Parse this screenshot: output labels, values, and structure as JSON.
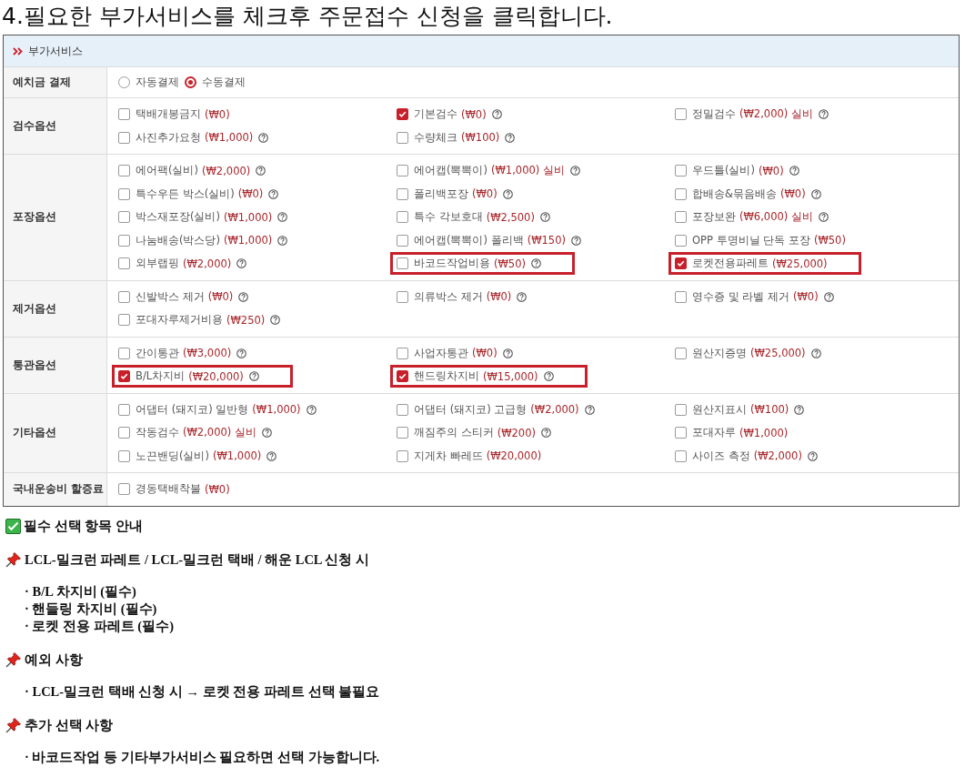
{
  "heading": "4.필요한 부가서비스를 체크후 주문접수 신청을 클릭합니다.",
  "panel": {
    "title": "부가서비스",
    "rows": [
      {
        "label": "예치금 결제",
        "kind": "radio",
        "options": [
          {
            "label": "자동결제",
            "selected": false
          },
          {
            "label": "수동결제",
            "selected": true
          }
        ]
      },
      {
        "label": "검수옵션",
        "kind": "checks",
        "options": [
          {
            "name": "택배개봉금지",
            "price": "(₩0)",
            "help": false,
            "checked": false,
            "highlighted": false
          },
          {
            "name": "기본검수",
            "price": "(₩0)",
            "help": true,
            "checked": true,
            "highlighted": false
          },
          {
            "name": "정밀검수",
            "price": "(₩2,000) 실비",
            "help": true,
            "checked": false,
            "highlighted": false
          },
          {
            "name": "사진추가요청",
            "price": "(₩1,000)",
            "help": true,
            "checked": false,
            "highlighted": false
          },
          {
            "name": "수량체크",
            "price": "(₩100)",
            "help": true,
            "checked": false,
            "highlighted": false
          }
        ]
      },
      {
        "label": "포장옵션",
        "kind": "checks",
        "options": [
          {
            "name": "에어팩(실비)",
            "price": "(₩2,000)",
            "help": true,
            "checked": false,
            "highlighted": false
          },
          {
            "name": "에어캡(뽁뽁이)",
            "price": "(₩1,000) 실비",
            "help": true,
            "checked": false,
            "highlighted": false
          },
          {
            "name": "우드틀(실비)",
            "price": "(₩0)",
            "help": true,
            "checked": false,
            "highlighted": false
          },
          {
            "name": "특수우든 박스(실비)",
            "price": "(₩0)",
            "help": true,
            "checked": false,
            "highlighted": false
          },
          {
            "name": "폴리백포장",
            "price": "(₩0)",
            "help": true,
            "checked": false,
            "highlighted": false
          },
          {
            "name": "합배송&묶음배송",
            "price": "(₩0)",
            "help": true,
            "checked": false,
            "highlighted": false
          },
          {
            "name": "박스재포장(실비)",
            "price": "(₩1,000)",
            "help": true,
            "checked": false,
            "highlighted": false
          },
          {
            "name": "특수 각보호대",
            "price": "(₩2,500)",
            "help": true,
            "checked": false,
            "highlighted": false
          },
          {
            "name": "포장보완",
            "price": "(₩6,000) 실비",
            "help": true,
            "checked": false,
            "highlighted": false
          },
          {
            "name": "나눔배송(박스당)",
            "price": "(₩1,000)",
            "help": true,
            "checked": false,
            "highlighted": false
          },
          {
            "name": "에어캡(뽁뽁이) 폴리백",
            "price": "(₩150)",
            "help": true,
            "checked": false,
            "highlighted": false
          },
          {
            "name": "OPP 투명비닐 단독 포장",
            "price": "(₩50)",
            "help": false,
            "checked": false,
            "highlighted": false
          },
          {
            "name": "외부랩핑",
            "price": "(₩2,000)",
            "help": true,
            "checked": false,
            "highlighted": false
          },
          {
            "name": "바코드작업비용",
            "price": "(₩50)",
            "help": true,
            "checked": false,
            "highlighted": true
          },
          {
            "name": "로켓전용파레트",
            "price": "(₩25,000)",
            "help": false,
            "checked": true,
            "highlighted": true
          }
        ]
      },
      {
        "label": "제거옵션",
        "kind": "checks",
        "options": [
          {
            "name": "신발박스 제거",
            "price": "(₩0)",
            "help": true,
            "checked": false,
            "highlighted": false
          },
          {
            "name": "의류박스 제거",
            "price": "(₩0)",
            "help": true,
            "checked": false,
            "highlighted": false
          },
          {
            "name": "영수증 및 라벨 제거",
            "price": "(₩0)",
            "help": true,
            "checked": false,
            "highlighted": false
          },
          {
            "name": "포대자루제거비용",
            "price": "(₩250)",
            "help": true,
            "checked": false,
            "highlighted": false
          }
        ]
      },
      {
        "label": "통관옵션",
        "kind": "checks",
        "options": [
          {
            "name": "간이통관",
            "price": "(₩3,000)",
            "help": true,
            "checked": false,
            "highlighted": false
          },
          {
            "name": "사업자통관",
            "price": "(₩0)",
            "help": true,
            "checked": false,
            "highlighted": false
          },
          {
            "name": "원산지증명",
            "price": "(₩25,000)",
            "help": true,
            "checked": false,
            "highlighted": false
          },
          {
            "name": "B/L차지비",
            "price": "(₩20,000)",
            "help": true,
            "checked": true,
            "highlighted": true
          },
          {
            "name": "핸드링차지비",
            "price": "(₩15,000)",
            "help": true,
            "checked": true,
            "highlighted": true
          }
        ]
      },
      {
        "label": "기타옵션",
        "kind": "checks",
        "options": [
          {
            "name": "어댑터 (돼지코) 일반형",
            "price": "(₩1,000)",
            "help": true,
            "checked": false,
            "highlighted": false
          },
          {
            "name": "어댑터 (돼지코) 고급형",
            "price": "(₩2,000)",
            "help": true,
            "checked": false,
            "highlighted": false
          },
          {
            "name": "원산지표시",
            "price": "(₩100)",
            "help": true,
            "checked": false,
            "highlighted": false
          },
          {
            "name": "작동검수",
            "price": "(₩2,000) 실비",
            "help": true,
            "checked": false,
            "highlighted": false
          },
          {
            "name": "깨짐주의 스티커",
            "price": "(₩200)",
            "help": true,
            "checked": false,
            "highlighted": false
          },
          {
            "name": "포대자루",
            "price": "(₩1,000)",
            "help": false,
            "checked": false,
            "highlighted": false
          },
          {
            "name": "노끈밴딩(실비)",
            "price": "(₩1,000)",
            "help": true,
            "checked": false,
            "highlighted": false
          },
          {
            "name": "지게차 빠레뜨",
            "price": "(₩20,000)",
            "help": false,
            "checked": false,
            "highlighted": false
          },
          {
            "name": "사이즈 측정",
            "price": "(₩2,000)",
            "help": true,
            "checked": false,
            "highlighted": false
          }
        ]
      },
      {
        "label": "국내운송비 할증료",
        "kind": "checks",
        "options": [
          {
            "name": "경동택배착불",
            "price": "(₩0)",
            "help": false,
            "checked": false,
            "highlighted": false
          }
        ]
      }
    ]
  },
  "notes": [
    {
      "kind": "check",
      "heading": "필수 선택 항목 안내"
    },
    {
      "kind": "pin",
      "heading": "LCL-밀크런 파레트 / LCL-밀크런 택배 / 해운 LCL 신청 시",
      "lines": [
        "· B/L 차지비 (필수)",
        "· 핸들링 차지비 (필수)",
        "· 로켓 전용 파레트 (필수)"
      ]
    },
    {
      "kind": "pin",
      "heading": "예외 사항",
      "lines": [
        "· LCL-밀크런 택배 신청 시 → 로켓 전용 파레트 선택 불필요"
      ]
    },
    {
      "kind": "pin",
      "heading": "추가 선택 사항",
      "lines": [
        "· 바코드작업 등 기타부가서비스 필요하면 선택 가능합니다."
      ]
    }
  ]
}
